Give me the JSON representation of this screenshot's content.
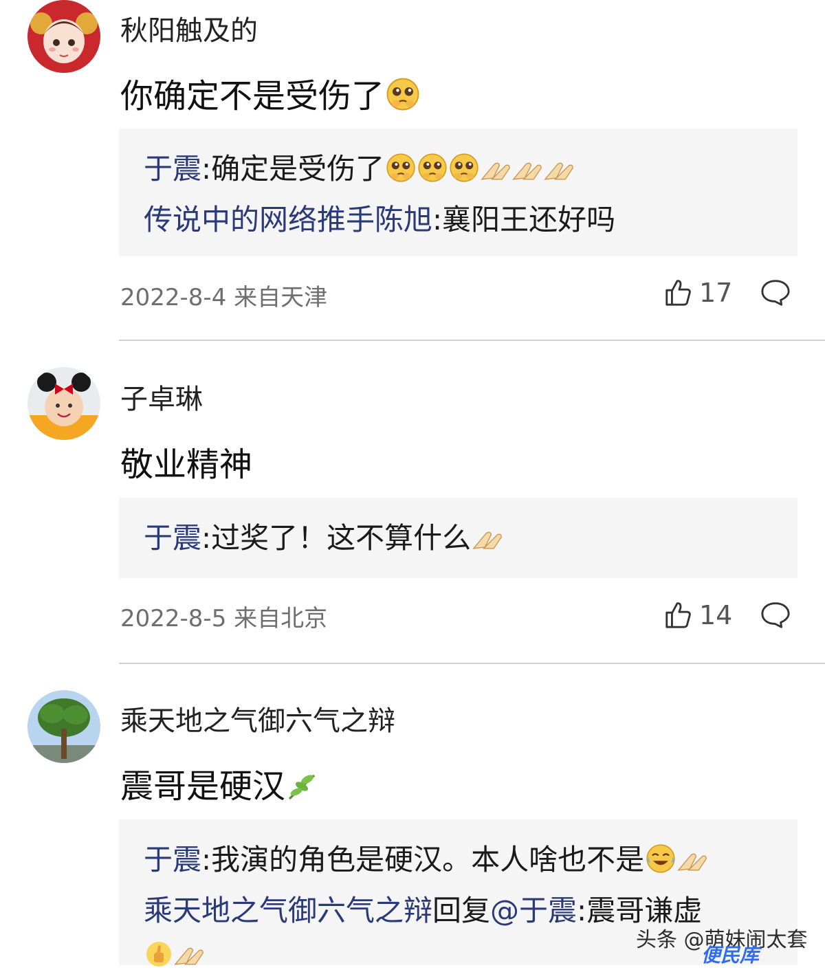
{
  "comments": [
    {
      "username": "秋阳触及的",
      "text": "你确定不是受伤了",
      "replies": [
        {
          "name": "于震",
          "sep": ":",
          "text": "确定是受伤了"
        },
        {
          "name": "传说中的网络推手陈旭",
          "sep": ":",
          "text": "襄阳王还好吗"
        }
      ],
      "date": "2022-8-4",
      "location": "来自天津",
      "likes": "17"
    },
    {
      "username": "子卓琳",
      "text": "敬业精神",
      "replies": [
        {
          "name": "于震",
          "sep": ":",
          "text": "过奖了！这不算什么"
        }
      ],
      "date": "2022-8-5",
      "location": "来自北京",
      "likes": "14"
    },
    {
      "username": "乘天地之气御六气之辩",
      "text": "震哥是硬汉",
      "replies": [
        {
          "name": "于震",
          "sep": ":",
          "text": "我演的角色是硬汉。本人啥也不是"
        },
        {
          "name": "乘天地之气御六气之辩",
          "mid": "回复",
          "name2": "@于震",
          "sep": ":",
          "text": "震哥谦虚"
        }
      ]
    }
  ],
  "watermark": {
    "line1": "头条 @萌妹闹太套",
    "line2": "便民库"
  },
  "icons": [
    "avatar-girl",
    "avatar-baby",
    "avatar-tree",
    "pleading-face-emoji",
    "pray-hands-emoji",
    "thumbs-up-emoji",
    "tears-of-joy-emoji",
    "leaf-emoji",
    "like-icon",
    "comment-icon"
  ],
  "colors": {
    "reply_name": "#2a3a78",
    "meta": "#6e6e6e",
    "reply_bg": "#f5f5f5"
  }
}
